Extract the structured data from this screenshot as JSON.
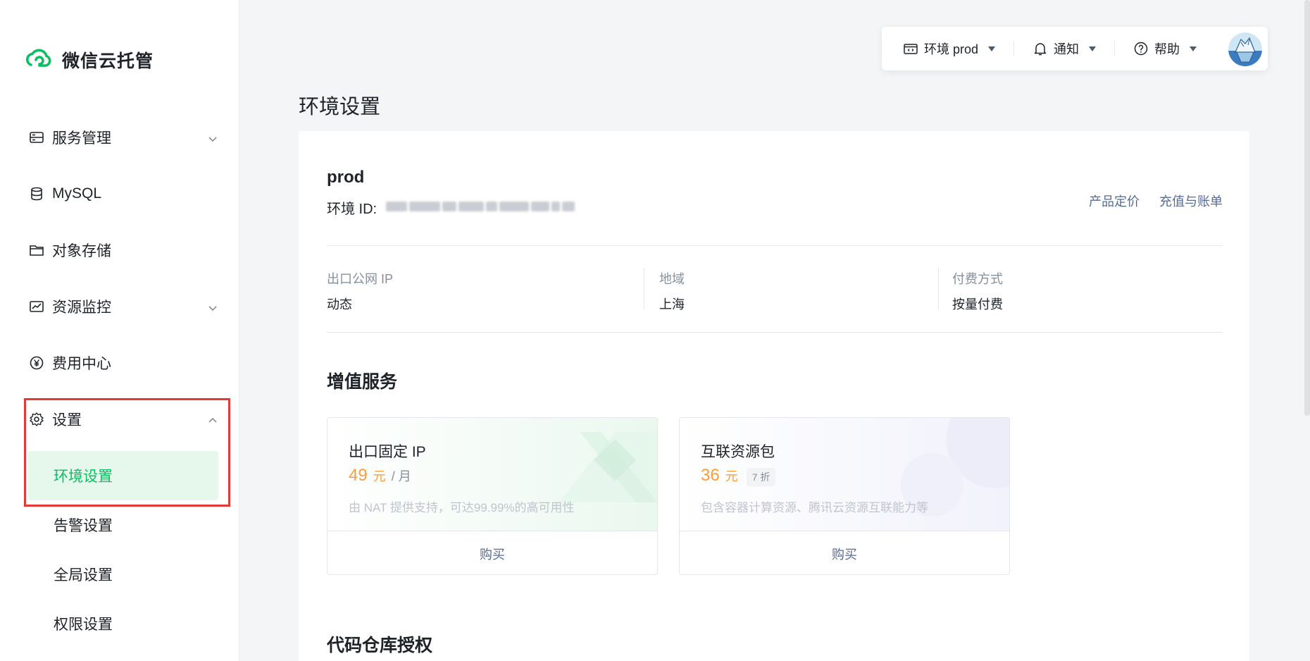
{
  "app": {
    "name": "微信云托管"
  },
  "sidebar": {
    "items": [
      {
        "label": "服务管理",
        "icon": "server-icon",
        "expandable": true
      },
      {
        "label": "MySQL",
        "icon": "database-icon",
        "expandable": false
      },
      {
        "label": "对象存储",
        "icon": "folder-icon",
        "expandable": false
      },
      {
        "label": "资源监控",
        "icon": "monitor-icon",
        "expandable": true
      },
      {
        "label": "费用中心",
        "icon": "yen-icon",
        "expandable": false
      },
      {
        "label": "设置",
        "icon": "gear-icon",
        "expandable": true,
        "expanded": true
      }
    ],
    "settings_sub": [
      {
        "label": "环境设置",
        "active": true
      },
      {
        "label": "告警设置"
      },
      {
        "label": "全局设置"
      },
      {
        "label": "权限设置"
      }
    ]
  },
  "topbar": {
    "env": "环境 prod",
    "notify": "通知",
    "help": "帮助"
  },
  "page": {
    "title": "环境设置"
  },
  "env": {
    "name": "prod",
    "id_label": "环境 ID:",
    "links": {
      "pricing": "产品定价",
      "billing": "充值与账单"
    }
  },
  "info": [
    {
      "label": "出口公网 IP",
      "value": "动态"
    },
    {
      "label": "地域",
      "value": "上海"
    },
    {
      "label": "付费方式",
      "value": "按量付费"
    }
  ],
  "value_added": {
    "title": "增值服务",
    "cards": [
      {
        "name": "出口固定 IP",
        "price": "49",
        "currency": "元",
        "unit": "/ 月",
        "discount": "",
        "desc": "由 NAT 提供支持，可达99.99%的高可用性",
        "action": "购买"
      },
      {
        "name": "互联资源包",
        "price": "36",
        "currency": "元",
        "unit": "",
        "discount": "7 折",
        "desc": "包含容器计算资源、腾讯云资源互联能力等",
        "action": "购买"
      }
    ]
  },
  "repo_auth": {
    "title": "代码仓库授权"
  },
  "colors": {
    "brand": "#07c160",
    "price": "#fa9d3b",
    "link": "#576b95",
    "highlight": "#e53935"
  }
}
